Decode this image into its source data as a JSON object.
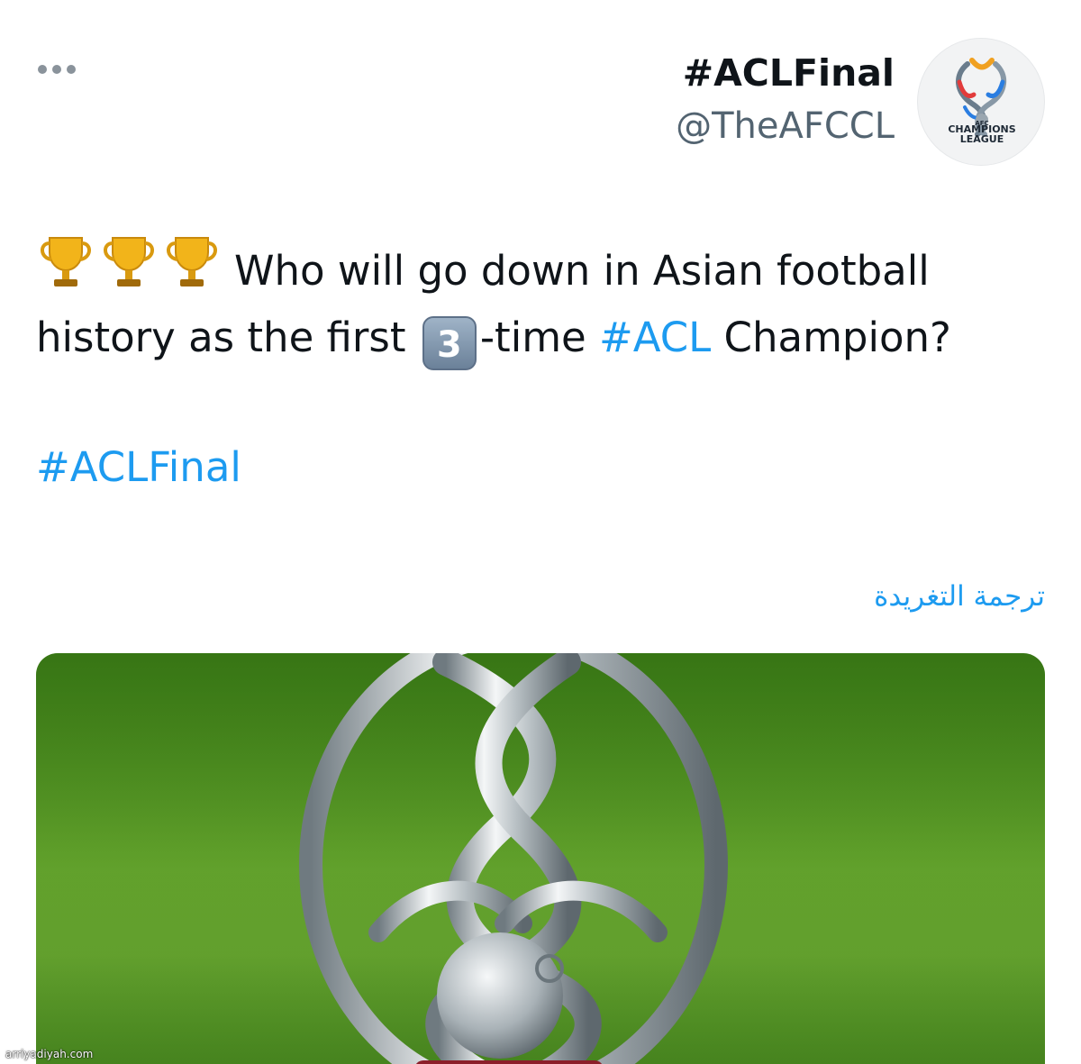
{
  "header": {
    "display_name": "#ACLFinal",
    "handle": "@TheAFCCL",
    "avatar_text": {
      "line1": "AFC",
      "line2": "CHAMPIONS",
      "line3": "LEAGUE"
    },
    "more_icon": "more-horizontal-icon"
  },
  "tweet": {
    "text_line1": "Who will go down in Asian football",
    "text_line2_a": "history as the first",
    "keycap": "3",
    "text_line2_b": "-time",
    "hashtag_inline": "#ACL",
    "text_line2_c": "Champion?",
    "hashtag_line": "#ACLFinal",
    "emoji_icon": "trophy-icon"
  },
  "translate_link": "ترجمة التغريدة",
  "watermark": "arriyadiyah.com",
  "colors": {
    "link": "#1d9bf0",
    "text": "#0f1419",
    "secondary": "#536471"
  }
}
